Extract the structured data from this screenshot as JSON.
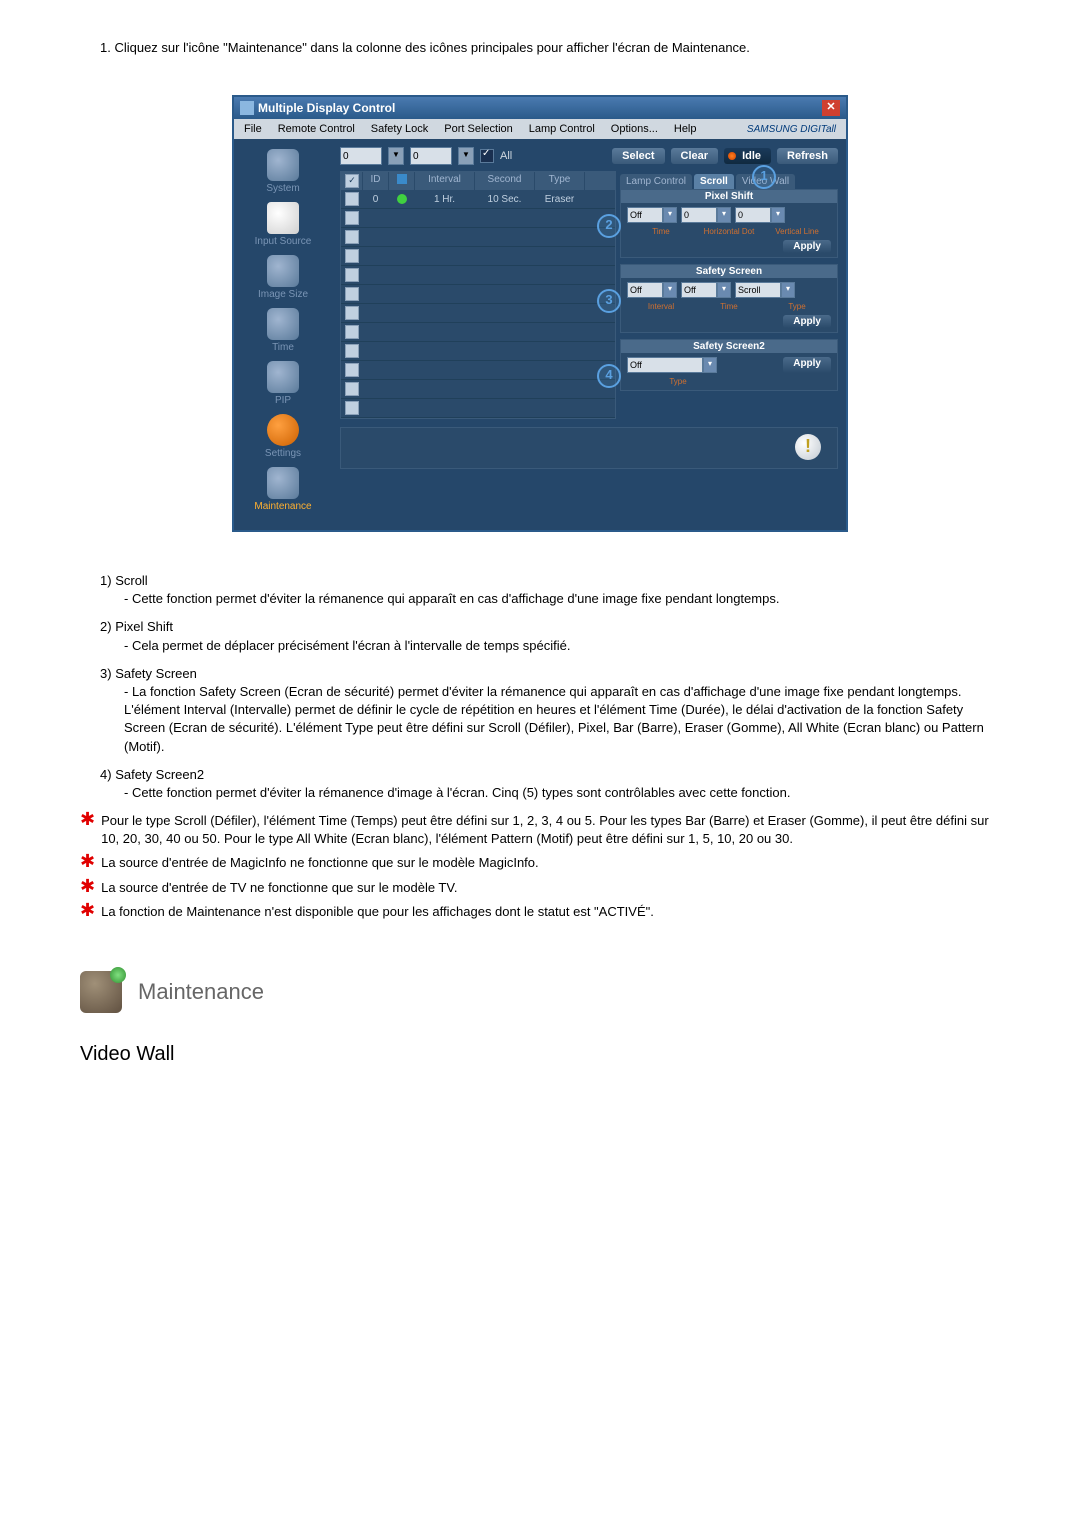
{
  "instruction": "1. Cliquez sur l'icône \"Maintenance\" dans la colonne des icônes principales pour afficher l'écran de Maintenance.",
  "window": {
    "title": "Multiple Display Control",
    "brand": "SAMSUNG DIGITall",
    "menu": [
      "File",
      "Remote Control",
      "Safety Lock",
      "Port Selection",
      "Lamp Control",
      "Options...",
      "Help"
    ]
  },
  "sidebar": {
    "items": [
      {
        "label": "System"
      },
      {
        "label": "Input Source"
      },
      {
        "label": "Image Size"
      },
      {
        "label": "Time"
      },
      {
        "label": "PIP"
      },
      {
        "label": "Settings"
      },
      {
        "label": "Maintenance"
      }
    ]
  },
  "top": {
    "val1": "0",
    "val2": "0",
    "all": "All",
    "select": "Select",
    "clear": "Clear",
    "idle": "Idle",
    "refresh": "Refresh"
  },
  "table": {
    "headers": {
      "chk": "",
      "id": "ID",
      "status": "",
      "interval": "Interval",
      "second": "Second",
      "type": "Type"
    },
    "rows": [
      {
        "id": "0",
        "interval": "1 Hr.",
        "second": "10 Sec.",
        "type": "Eraser",
        "status": "green",
        "checked": false
      }
    ]
  },
  "tabs": {
    "lamp": "Lamp Control",
    "scroll": "Scroll",
    "video": "Video Wall"
  },
  "panels": {
    "pixel": {
      "title": "Pixel Shift",
      "time": "Off",
      "hdot": "0",
      "vline": "0",
      "labels": {
        "time": "Time",
        "hdot": "Horizontal Dot",
        "vline": "Vertical Line"
      },
      "apply": "Apply"
    },
    "safety": {
      "title": "Safety Screen",
      "interval": "Off",
      "time": "Off",
      "type": "Scroll",
      "labels": {
        "interval": "Interval",
        "time": "Time",
        "type": "Type"
      },
      "apply": "Apply"
    },
    "safety2": {
      "title": "Safety Screen2",
      "type": "Off",
      "labels": {
        "type": "Type"
      },
      "apply": "Apply"
    }
  },
  "callouts": {
    "c1": "1",
    "c2": "2",
    "c3": "3",
    "c4": "4"
  },
  "descriptions": [
    {
      "num": "1)",
      "title": "Scroll",
      "body": "- Cette fonction permet d'éviter la rémanence qui apparaît en cas d'affichage d'une image fixe pendant longtemps."
    },
    {
      "num": "2)",
      "title": "Pixel Shift",
      "body": "- Cela permet de déplacer précisément l'écran à l'intervalle de temps spécifié."
    },
    {
      "num": "3)",
      "title": "Safety Screen",
      "body": "- La fonction Safety Screen (Ecran de sécurité) permet d'éviter la rémanence qui apparaît en cas d'affichage d'une image fixe pendant longtemps. L'élément Interval (Intervalle) permet de définir le cycle de répétition en heures et l'élément Time (Durée), le délai d'activation de la fonction Safety Screen (Ecran de sécurité). L'élément Type peut être défini sur Scroll (Défiler), Pixel, Bar (Barre), Eraser (Gomme), All White (Ecran blanc) ou Pattern (Motif)."
    },
    {
      "num": "4)",
      "title": "Safety Screen2",
      "body": "- Cette fonction permet d'éviter la rémanence d'image à l'écran. Cinq (5) types sont contrôlables avec cette fonction."
    }
  ],
  "notes": [
    "Pour le type Scroll (Défiler), l'élément Time (Temps) peut être défini sur 1, 2, 3, 4 ou 5. Pour les types Bar (Barre) et Eraser (Gomme), il peut être défini sur 10, 20, 30, 40 ou 50. Pour le type All White (Ecran blanc), l'élément Pattern (Motif) peut être défini sur 1, 5, 10, 20 ou 30.",
    "La source d'entrée de MagicInfo ne fonctionne que sur le modèle MagicInfo.",
    "La source d'entrée de TV ne fonctionne que sur le modèle TV.",
    "La fonction de Maintenance n'est disponible que pour les affichages dont le statut est \"ACTIVÉ\"."
  ],
  "section": {
    "title": "Maintenance"
  },
  "subsection": {
    "title": "Video Wall"
  }
}
